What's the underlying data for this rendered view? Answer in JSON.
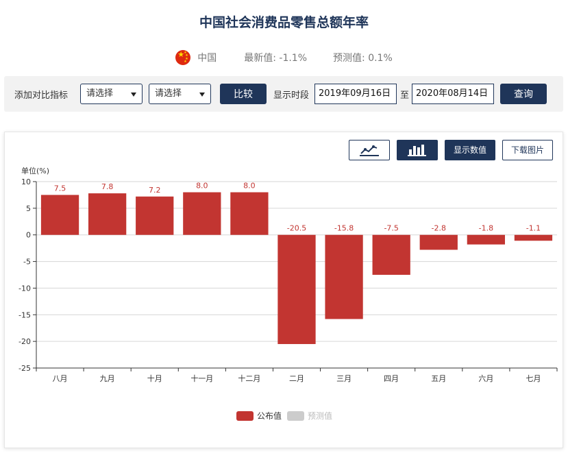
{
  "page": {
    "title": "中国社会消费品零售总额年率",
    "country": "中国",
    "latest_label": "最新值:",
    "latest_value": "-1.1%",
    "forecast_label": "预测值:",
    "forecast_value": "0.1%"
  },
  "toolbar": {
    "compare_label": "添加对比指标",
    "select1": "请选择",
    "select2": "请选择",
    "compare_button": "比较",
    "period_label": "显示时段",
    "start_date": "2019年09月16日",
    "to_label": "至",
    "end_date": "2020年08月14日",
    "query_button": "查询"
  },
  "chart_tools": {
    "line_icon": "line-chart-icon",
    "bar_icon": "bar-chart-icon",
    "show_values": "显示数值",
    "download": "下载图片"
  },
  "colors": {
    "brand": "#1f3559",
    "bar": "#c23531",
    "forecast": "#cccccc"
  },
  "chart_data": {
    "type": "bar",
    "ylabel": "单位(%)",
    "ylim": [
      -25,
      10
    ],
    "yticks": [
      10,
      5,
      0,
      -5,
      -10,
      -15,
      -20,
      -25
    ],
    "categories": [
      "八月",
      "九月",
      "十月",
      "十一月",
      "十二月",
      "二月",
      "三月",
      "四月",
      "五月",
      "六月",
      "七月"
    ],
    "series": [
      {
        "name": "公布值",
        "values": [
          7.5,
          7.8,
          7.2,
          8.0,
          8.0,
          -20.5,
          -15.8,
          -7.5,
          -2.8,
          -1.8,
          -1.1
        ]
      },
      {
        "name": "预测值",
        "values": []
      }
    ],
    "labels": [
      "7.5",
      "7.8",
      "7.2",
      "8.0",
      "8.0",
      "-20.5",
      "-15.8",
      "-7.5",
      "-2.8",
      "-1.8",
      "-1.1"
    ],
    "grid": true,
    "legend_position": "bottom-center"
  }
}
